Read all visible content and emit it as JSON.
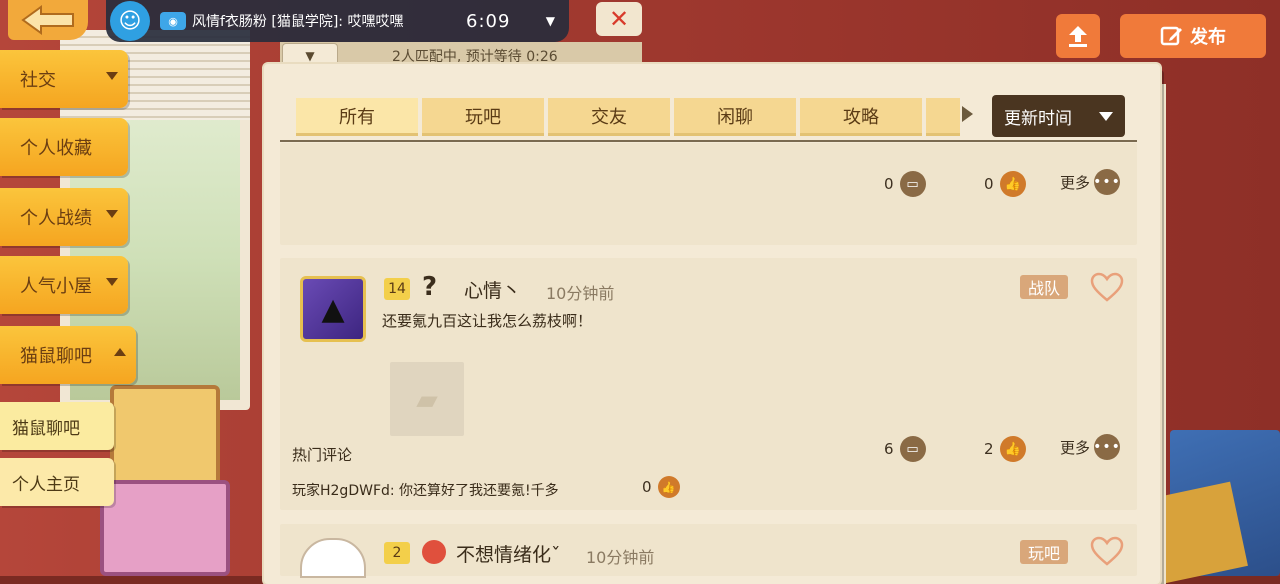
{
  "stream": {
    "title": "风情f衣肠粉 [猫鼠学院]: 哎嘿哎嘿",
    "time": "6:09"
  },
  "match": {
    "status": "2人匹配中, 预计等待 0:26"
  },
  "header": {
    "post_label": "发布"
  },
  "sidebar": {
    "items": [
      {
        "label": "社交"
      },
      {
        "label": "个人收藏"
      },
      {
        "label": "个人战绩"
      },
      {
        "label": "人气小屋"
      },
      {
        "label": "猫鼠聊吧"
      }
    ],
    "subitems": [
      {
        "label": "猫鼠聊吧"
      },
      {
        "label": "个人主页"
      }
    ]
  },
  "tabs": [
    {
      "label": "所有"
    },
    {
      "label": "玩吧"
    },
    {
      "label": "交友"
    },
    {
      "label": "闲聊"
    },
    {
      "label": "攻略"
    }
  ],
  "sort": {
    "selected": "更新时间"
  },
  "posts": [
    {
      "comments": "0",
      "likes": "0",
      "more": "更多"
    },
    {
      "level": "14",
      "username": "心情丶",
      "time": "10分钟前",
      "text": "还要氪九百这让我怎么荔枝啊！",
      "tag": "战队",
      "hot_label": "热门评论",
      "comments": "6",
      "likes": "2",
      "more": "更多",
      "top_comment": {
        "text": "玩家H2gDWFd: 你还算好了我还要氪!千多",
        "likes": "0"
      }
    },
    {
      "level": "2",
      "username": "不想情绪化ˇ",
      "time": "10分钟前",
      "tag": "玩吧"
    }
  ],
  "colors": {
    "accent": "#f5a520",
    "post_button": "#f07a3a",
    "paper": "#f4ead6"
  }
}
